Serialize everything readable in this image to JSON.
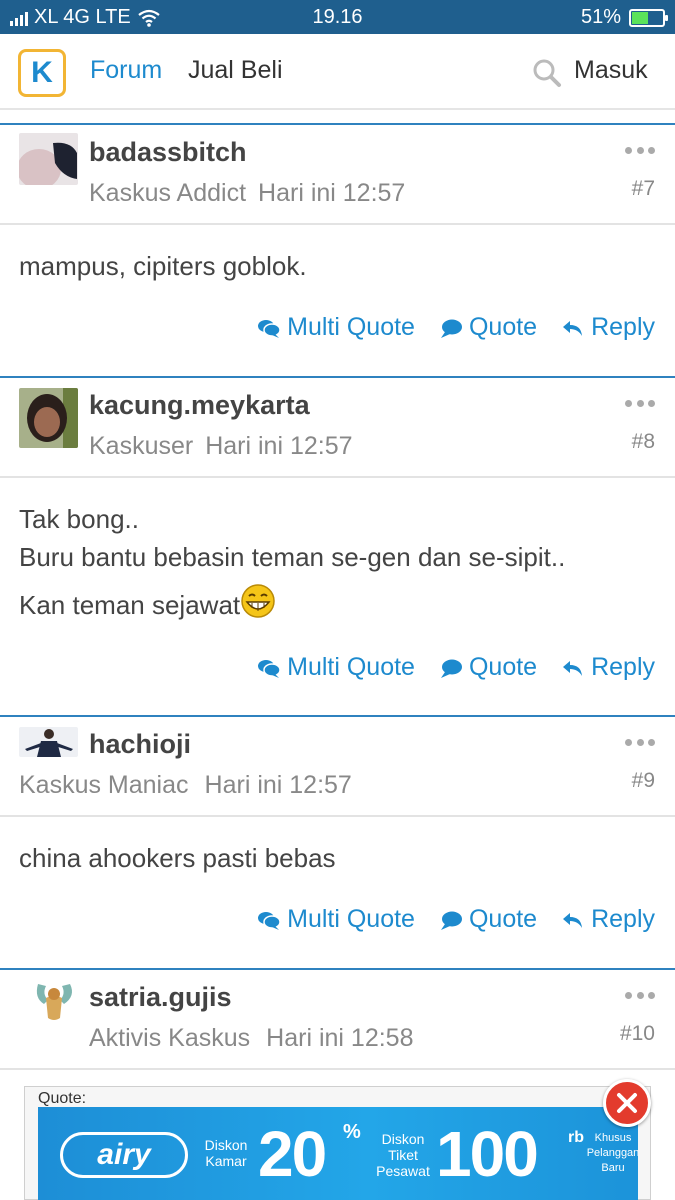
{
  "status_bar": {
    "carrier": "XL 4G LTE",
    "time": "19.16",
    "battery": "51%",
    "battery_level": 0.51
  },
  "header": {
    "logo_letter": "K",
    "nav_forum": "Forum",
    "nav_jual_beli": "Jual Beli",
    "login": "Masuk"
  },
  "actions": {
    "multi_quote": "Multi Quote",
    "quote": "Quote",
    "reply": "Reply"
  },
  "posts": [
    {
      "username": "badassbitch",
      "rank": "Kaskus Addict",
      "time": "Hari ini 12:57",
      "number": "#7",
      "lines": [
        "mampus, cipiters goblok."
      ]
    },
    {
      "username": "kacung.meykarta",
      "rank": "Kaskuser",
      "time": "Hari ini 12:57",
      "number": "#8",
      "lines": [
        "Tak bong..",
        "Buru bantu bebasin teman se-gen dan se-sipit..",
        "Kan teman sejawat"
      ]
    },
    {
      "username": "hachioji",
      "rank": "Kaskus Maniac",
      "time": "Hari ini 12:57",
      "number": "#9",
      "lines": [
        "china ahookers pasti bebas"
      ]
    },
    {
      "username": "satria.gujis",
      "rank": "Aktivis Kaskus",
      "time": "Hari ini 12:58",
      "number": "#10",
      "quote_label": "Quote:"
    }
  ],
  "ad": {
    "brand": "airy",
    "diskon_kamar": "Diskon Kamar",
    "value1": "20",
    "percent": "%",
    "diskon_tiket": "Diskon Tiket Pesawat",
    "value2": "100",
    "unit": "rb",
    "khusus": "Khusus Pelanggan Baru"
  },
  "colors": {
    "accent": "#1d8ace",
    "status_bar": "#1f5f8e",
    "post_border": "#2f82bf",
    "logo_border": "#f2b534",
    "close_button": "#e33b2d"
  }
}
